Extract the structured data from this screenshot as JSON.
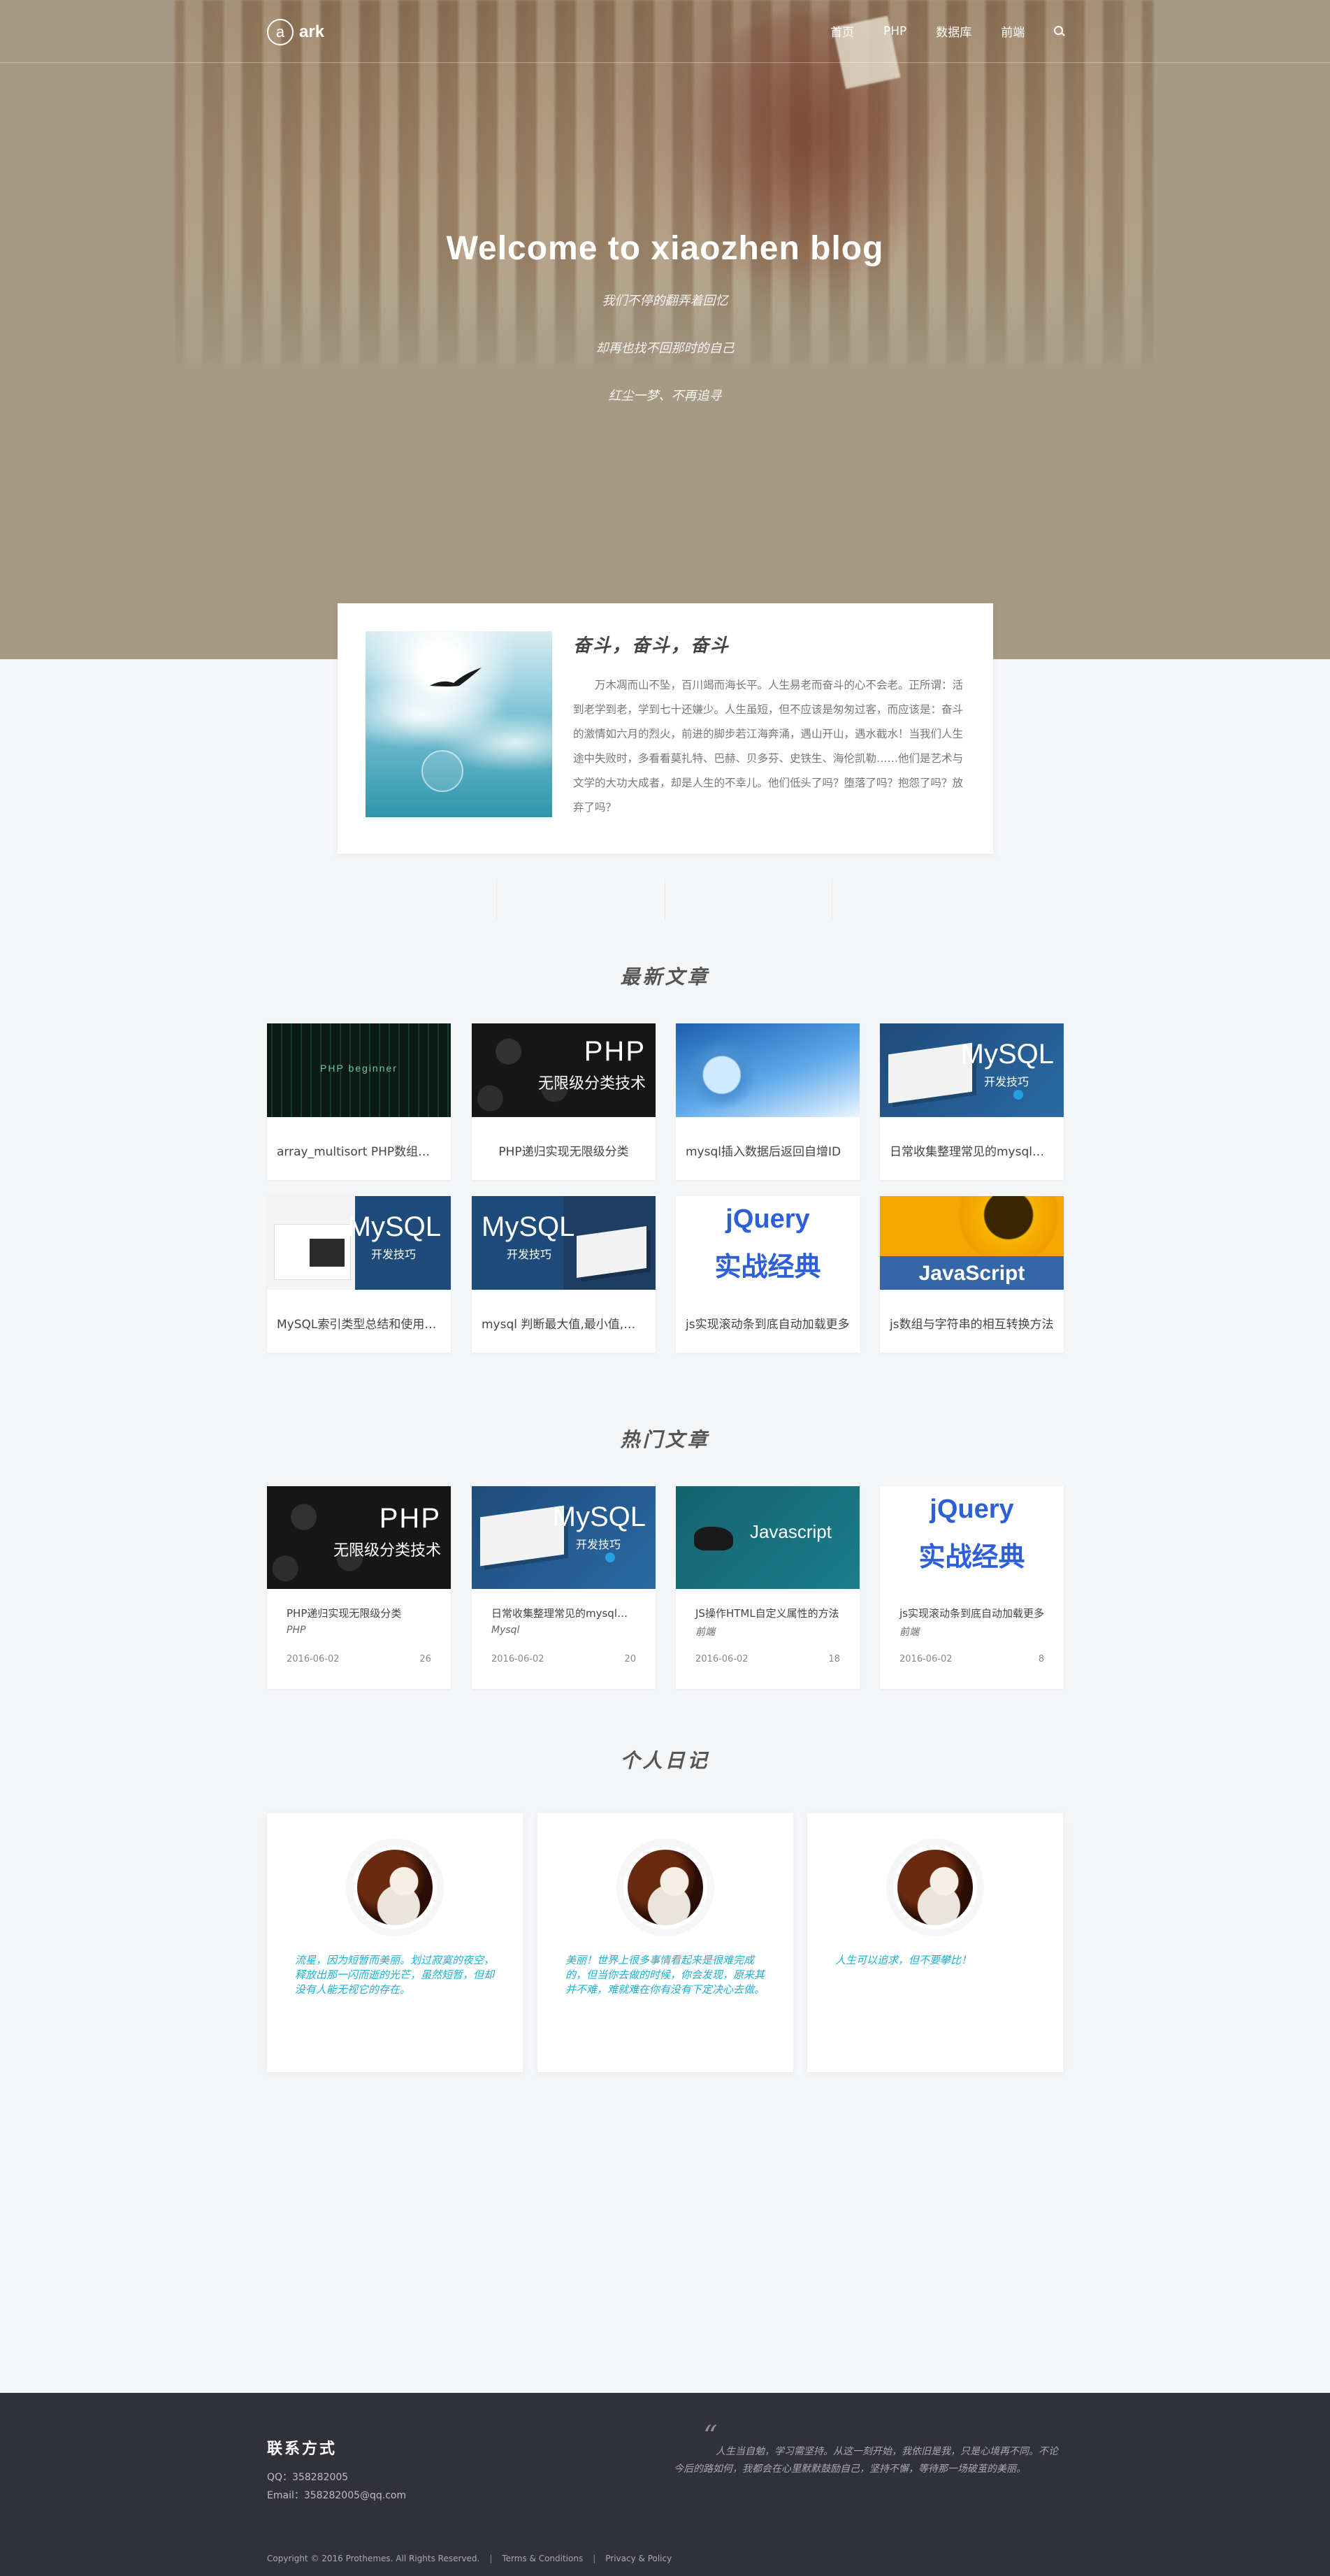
{
  "header": {
    "logo_letter": "a",
    "logo_text": "ark",
    "nav": [
      "首页",
      "PHP",
      "数据库",
      "前端"
    ],
    "search_icon": "search-icon"
  },
  "hero": {
    "title": "Welcome to xiaozhen blog",
    "lines": [
      "我们不停的翻弄着回忆",
      "却再也找不回那时的自己",
      "红尘一梦、不再追寻"
    ]
  },
  "about": {
    "title": "奋斗，奋斗，奋斗",
    "text": "万木凋而山不坠，百川竭而海长平。人生易老而奋斗的心不会老。正所谓：活到老学到老，学到七十还嫌少。人生虽短，但不应该是匆匆过客，而应该是：奋斗的激情如六月的烈火，前进的脚步若江海奔涌，遇山开山，遇水截水！当我们人生途中失败时，多看看莫扎特、巴赫、贝多芬、史铁生、海伦凯勒……他们是艺术与文学的大功大成者，却是人生的不幸儿。他们低头了吗？堕落了吗？抱怨了吗？放弃了吗？"
  },
  "latest": {
    "title": "最新文章",
    "items": [
      {
        "title": "array_multisort PHP数组多维排序",
        "thumb_text": "PHP beginner"
      },
      {
        "title": "PHP递归实现无限级分类",
        "thumb_big": "PHP",
        "thumb_sub": "无限级分类技术"
      },
      {
        "title": "mysql插入数据后返回自增ID"
      },
      {
        "title": "日常收集整理常见的mysql语句",
        "thumb_big": "MySQL",
        "thumb_sub": "开发技巧"
      },
      {
        "title": "MySQL索引类型总结和使用技巧",
        "thumb_big": "MySQL",
        "thumb_sub": "开发技巧"
      },
      {
        "title": "mysql 判断最大值,最小值,平均值",
        "thumb_big": "MySQL",
        "thumb_sub": "开发技巧"
      },
      {
        "title": "js实现滚动条到底自动加载更多",
        "thumb_big": "jQuery",
        "thumb_sub": "实战经典"
      },
      {
        "title": "js数组与字符串的相互转换方法",
        "thumb_big": "JavaScript"
      }
    ]
  },
  "hot": {
    "title": "热门文章",
    "items": [
      {
        "title": "PHP递归实现无限级分类",
        "category": "PHP",
        "date": "2016-06-02",
        "count": "26",
        "thumb_big": "PHP",
        "thumb_sub": "无限级分类技术"
      },
      {
        "title": "日常收集整理常见的mysql语句",
        "category": "Mysql",
        "date": "2016-06-02",
        "count": "20",
        "thumb_big": "MySQL",
        "thumb_sub": "开发技巧"
      },
      {
        "title": "JS操作HTML自定义属性的方法",
        "category": "前端",
        "date": "2016-06-02",
        "count": "18",
        "thumb_big": "Javascript"
      },
      {
        "title": "js实现滚动条到底自动加载更多",
        "category": "前端",
        "date": "2016-06-02",
        "count": "8",
        "thumb_big": "jQuery",
        "thumb_sub": "实战经典"
      }
    ]
  },
  "diary": {
    "title": "个人日记",
    "items": [
      {
        "text": "流星，因为短暂而美丽。划过寂寞的夜空，释放出那一闪而逝的光芒，虽然短暂，但却没有人能无视它的存在。"
      },
      {
        "text": "美丽！世界上很多事情看起来是很难完成的，但当你去做的时候，你会发现，原来其并不难，难就难在你有没有下定决心去做。"
      },
      {
        "text": "人生可以追求，但不要攀比！"
      }
    ]
  },
  "footer": {
    "title": "联系方式",
    "qq": "QQ：358282005",
    "email": "Email：358282005@qq.com",
    "quote": "人生当自勉，学习需坚持。从这一刻开始，我依旧是我，只是心境再不同。不论今后的路如何，我都会在心里默默鼓励自己，坚持不懈，等待那一场破茧的美丽。",
    "copyright": "Copyright © 2016 Prothemes. All Rights Reserved.",
    "terms": "Terms & Conditions",
    "privacy": "Privacy & Policy"
  }
}
